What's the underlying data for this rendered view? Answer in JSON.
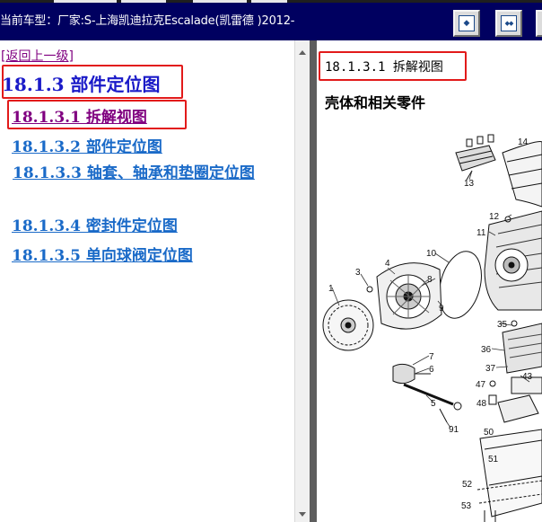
{
  "header": {
    "title": "当前车型：厂家:S-上海凯迪拉克Escalade(凯雷德 )2012-",
    "background_color": "#000060",
    "buttons": [
      {
        "icon": "nav-single-icon",
        "glyph": "◆"
      },
      {
        "icon": "nav-double-icon",
        "glyph": "◆◆"
      }
    ]
  },
  "left_pane": {
    "back_link": "[返回上一级]",
    "section_title": "18.1.3 部件定位图",
    "links": [
      "18.1.3.1 拆解视图",
      "18.1.3.2 部件定位图",
      "18.1.3.3 轴套、轴承和垫圈定位图",
      "18.1.3.4 密封件定位图",
      "18.1.3.5 单向球阀定位图"
    ],
    "link_color": "#1a6ac8",
    "visited_link_color": "#800080",
    "title_color": "#1a1ac8",
    "highlight_color": "#e21a1a"
  },
  "right_pane": {
    "title": "18.1.3.1 拆解视图",
    "subtitle": "壳体和相关零件",
    "callouts": [
      "13",
      "12",
      "11",
      "10",
      "8",
      "9",
      "4",
      "3",
      "1",
      "7",
      "6",
      "5",
      "91",
      "35",
      "36",
      "37",
      "47",
      "48",
      "43",
      "50",
      "51",
      "52",
      "53"
    ]
  }
}
